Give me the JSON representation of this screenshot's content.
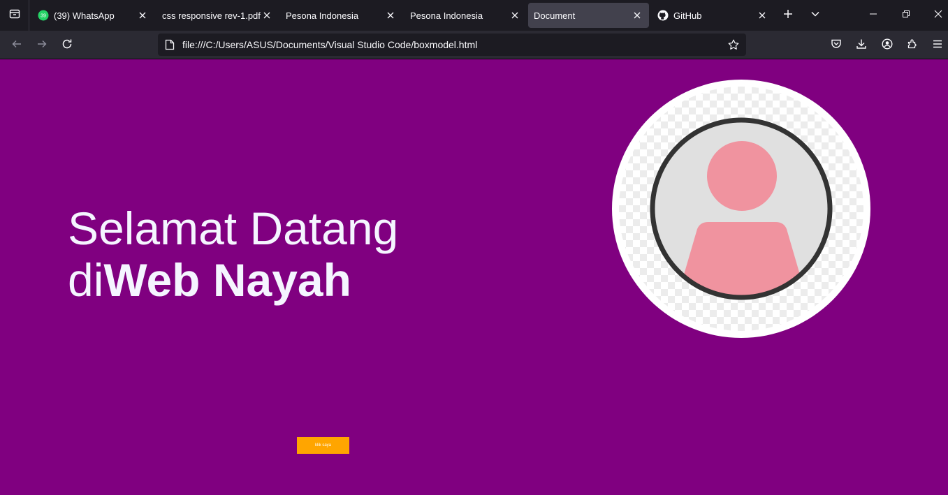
{
  "browser": {
    "tabs": [
      {
        "label": "(39) WhatsApp",
        "favicon": "whatsapp-icon",
        "badge": "39",
        "active": false
      },
      {
        "label": "css responsive rev-1.pdf",
        "favicon": "",
        "active": false
      },
      {
        "label": "Pesona Indonesia",
        "favicon": "",
        "active": false
      },
      {
        "label": "Pesona Indonesia",
        "favicon": "",
        "active": false
      },
      {
        "label": "Document",
        "favicon": "",
        "active": true
      },
      {
        "label": "GitHub",
        "favicon": "github-icon",
        "active": false
      }
    ],
    "url": "file:///C:/Users/ASUS/Documents/Visual Studio Code/boxmodel.html"
  },
  "page": {
    "heading_line1": "Selamat Datang",
    "heading_prefix": "di",
    "heading_strong": "Web Nayah",
    "button_label": "klik saya",
    "background_color": "#800080",
    "button_color": "#ffa500",
    "avatar": {
      "icon": "user-avatar-icon",
      "figure_color": "#f0939f",
      "ring_color": "#333333"
    }
  }
}
